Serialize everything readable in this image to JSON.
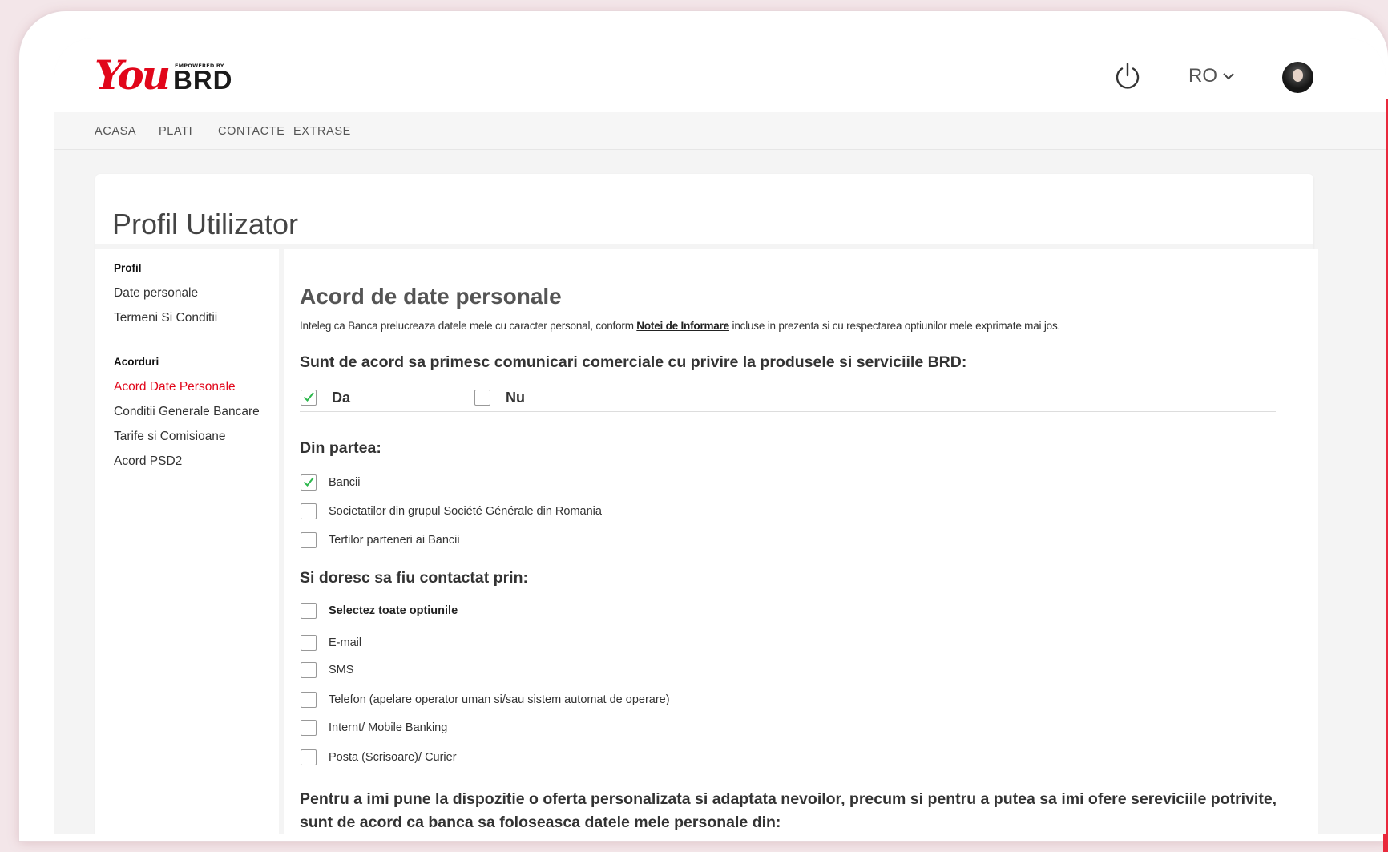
{
  "header": {
    "logo": {
      "brand": "You",
      "tagline": "EMPOWERED BY",
      "bank": "BRD",
      "brand_color": "#e1061a"
    },
    "language": "RO",
    "icons": {
      "logout": "power-icon",
      "language_dropdown": "chevron-down-icon",
      "user": "avatar"
    }
  },
  "nav": {
    "items": [
      "ACASA",
      "PLATI",
      "CONTACTE",
      "EXTRASE"
    ]
  },
  "page": {
    "title": "Profil Utilizator"
  },
  "sidebar": {
    "groups": [
      {
        "heading": "Profil",
        "items": [
          "Date personale",
          "Termeni Si Conditii"
        ]
      },
      {
        "heading": "Acorduri",
        "items": [
          "Acord Date Personale",
          "Conditii Generale Bancare",
          "Tarife si Comisioane",
          "Acord PSD2"
        ]
      }
    ],
    "active_item": "Acord Date Personale"
  },
  "content": {
    "title": "Acord de date personale",
    "intro": {
      "before": "Inteleg ca Banca prelucreaza datele mele cu caracter personal, conform ",
      "link": "Notei de Informare",
      "after": " incluse in prezenta si cu respectarea optiunilor mele exprimate mai jos."
    },
    "consent": {
      "question": "Sunt de acord sa primesc comunicari comerciale cu privire la produsele si serviciile BRD:",
      "options": [
        {
          "label": "Da",
          "checked": true
        },
        {
          "label": "Nu",
          "checked": false
        }
      ]
    },
    "from": {
      "heading": "Din partea:",
      "options": [
        {
          "label": "Bancii",
          "checked": true
        },
        {
          "label": "Societatilor din grupul Société Générale din Romania",
          "checked": false
        },
        {
          "label": "Tertilor parteneri ai Bancii",
          "checked": false
        }
      ]
    },
    "contact": {
      "heading": "Si doresc sa fiu contactat prin:",
      "select_all": {
        "label": "Selectez toate optiunile",
        "checked": false
      },
      "options": [
        {
          "label": "E-mail",
          "checked": false
        },
        {
          "label": "SMS",
          "checked": false
        },
        {
          "label": "Telefon (apelare operator uman si/sau sistem automat de operare)",
          "checked": false
        },
        {
          "label": "Internt/ Mobile Banking",
          "checked": false
        },
        {
          "label": "Posta (Scrisoare)/ Curier",
          "checked": false
        }
      ]
    },
    "offer_question": "Pentru a imi pune la dispozitie o oferta personalizata si adaptata nevoilor, precum si pentru a putea sa imi ofere sereviciile potrivite, sunt de acord ca banca sa foloseasca datele mele personale din:"
  },
  "colors": {
    "accent": "#e1061a",
    "check": "#2db84d"
  }
}
